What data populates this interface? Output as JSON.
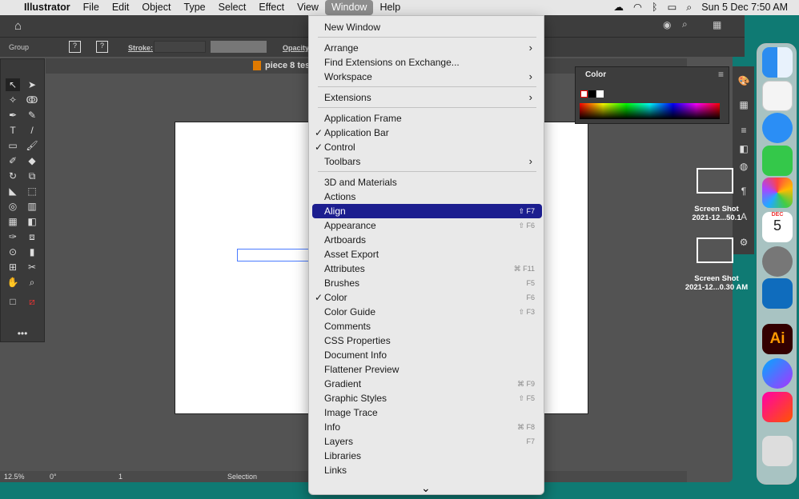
{
  "menubar": {
    "app": "Illustrator",
    "items": [
      "File",
      "Edit",
      "Object",
      "Type",
      "Select",
      "Effect",
      "View",
      "Window",
      "Help"
    ],
    "clock": "Sun 5 Dec  7:50 AM"
  },
  "control": {
    "selection": "Group",
    "stroke_label": "Stroke:",
    "opacity_label": "Opacity:"
  },
  "document": {
    "tab_title": "piece 8 tes"
  },
  "color_panel": {
    "title": "Color"
  },
  "status": {
    "zoom": "12.5%",
    "rotation": "0°",
    "artboard": "1",
    "tool": "Selection"
  },
  "window_menu": {
    "items": [
      {
        "label": "New Window"
      },
      {
        "sep": true
      },
      {
        "label": "Arrange",
        "submenu": true
      },
      {
        "label": "Find Extensions on Exchange..."
      },
      {
        "label": "Workspace",
        "submenu": true
      },
      {
        "sep": true
      },
      {
        "label": "Extensions",
        "submenu": true
      },
      {
        "sep": true
      },
      {
        "label": "Application Frame"
      },
      {
        "label": "Application Bar",
        "checked": true
      },
      {
        "label": "Control",
        "checked": true
      },
      {
        "label": "Toolbars",
        "submenu": true
      },
      {
        "sep": true
      },
      {
        "label": "3D and Materials"
      },
      {
        "label": "Actions"
      },
      {
        "label": "Align",
        "shortcut": "⇧ F7",
        "highlighted": true
      },
      {
        "label": "Appearance",
        "shortcut": "⇧ F6"
      },
      {
        "label": "Artboards"
      },
      {
        "label": "Asset Export"
      },
      {
        "label": "Attributes",
        "shortcut": "⌘ F11"
      },
      {
        "label": "Brushes",
        "shortcut": "F5"
      },
      {
        "label": "Color",
        "shortcut": "F6",
        "checked": true
      },
      {
        "label": "Color Guide",
        "shortcut": "⇧ F3"
      },
      {
        "label": "Comments"
      },
      {
        "label": "CSS Properties"
      },
      {
        "label": "Document Info"
      },
      {
        "label": "Flattener Preview"
      },
      {
        "label": "Gradient",
        "shortcut": "⌘ F9"
      },
      {
        "label": "Graphic Styles",
        "shortcut": "⇧ F5"
      },
      {
        "label": "Image Trace"
      },
      {
        "label": "Info",
        "shortcut": "⌘ F8"
      },
      {
        "label": "Layers",
        "shortcut": "F7"
      },
      {
        "label": "Libraries"
      },
      {
        "label": "Links"
      }
    ],
    "scroll_arrow": "⌄"
  },
  "desktop": {
    "files": [
      {
        "name1": "Screen Shot",
        "name2": "2021-12...50.1"
      },
      {
        "name1": "Screen Shot",
        "name2": "2021-12...0.30 AM"
      }
    ]
  },
  "dock": {
    "calendar_month": "DEC",
    "calendar_day": "5",
    "ai_label": "Ai"
  },
  "colors": {
    "menu_highlight": "#1c1e8f",
    "desktop": "#0f7a73",
    "app_bg": "#535353"
  }
}
